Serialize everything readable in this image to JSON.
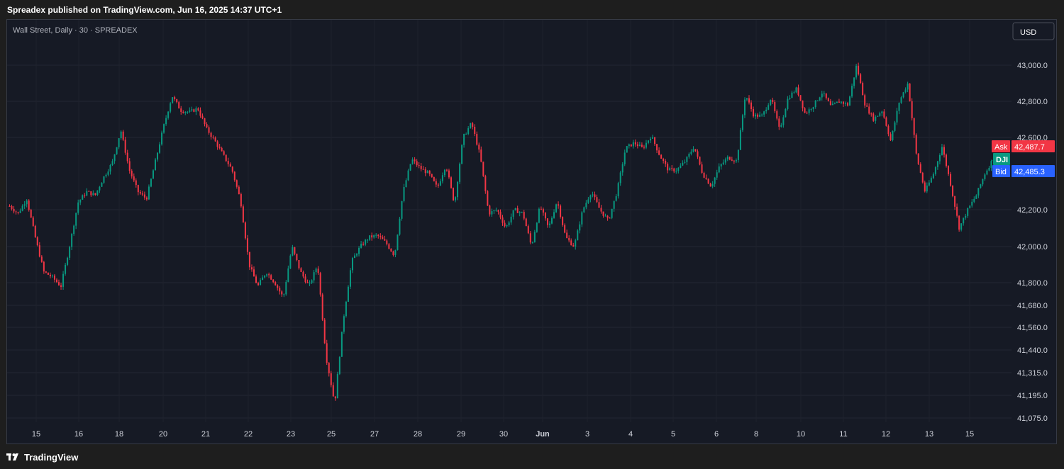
{
  "header": {
    "published_text": "Spreadex published on TradingView.com, Jun 16, 2025 14:37 UTC+1"
  },
  "footer": {
    "logo_text": "TradingView"
  },
  "chart_data": {
    "type": "candlestick",
    "symbol_label": "Wall Street, Daily · 30 · SPREADEX",
    "currency": "USD",
    "price_scale": {
      "ticks": [
        "43,000.0",
        "42,800.0",
        "42,600.0",
        "42,200.0",
        "42,000.0",
        "41,800.0",
        "41,680.0",
        "41,560.0",
        "41,440.0",
        "41,315.0",
        "41,195.0",
        "41,075.0"
      ],
      "tick_values": [
        43000,
        42800,
        42600,
        42200,
        42000,
        41800,
        41680,
        41560,
        41440,
        41315,
        41195,
        41075
      ],
      "range": [
        41075,
        43100
      ]
    },
    "time_scale": {
      "labels": [
        "15",
        "16",
        "18",
        "20",
        "21",
        "22",
        "23",
        "25",
        "27",
        "28",
        "29",
        "30",
        "Jun",
        "3",
        "4",
        "5",
        "6",
        "8",
        "10",
        "11",
        "12",
        "13",
        "15"
      ]
    },
    "markers": {
      "ask": {
        "label": "Ask",
        "value": "42,487.7",
        "color": "#f23645"
      },
      "bid": {
        "label": "Bid",
        "value": "42,485.3",
        "color": "#2962ff"
      },
      "symbol": {
        "label": "DJI",
        "color": "#089981"
      }
    },
    "series": [
      {
        "name": "DJI",
        "approx_path_values": [
          42220,
          42180,
          42260,
          42050,
          41860,
          41830,
          41780,
          42000,
          42240,
          42300,
          42280,
          42380,
          42460,
          42640,
          42420,
          42300,
          42260,
          42460,
          42660,
          42830,
          42750,
          42740,
          42760,
          42650,
          42580,
          42500,
          42420,
          42250,
          41900,
          41780,
          41860,
          41800,
          41720,
          42000,
          41860,
          41780,
          41900,
          41400,
          41150,
          41600,
          41920,
          42000,
          42050,
          42060,
          42020,
          41950,
          42300,
          42480,
          42430,
          42400,
          42320,
          42450,
          42230,
          42600,
          42680,
          42500,
          42180,
          42200,
          42100,
          42200,
          42180,
          42000,
          42220,
          42100,
          42250,
          42050,
          42000,
          42200,
          42300,
          42200,
          42140,
          42300,
          42540,
          42570,
          42540,
          42610,
          42500,
          42420,
          42420,
          42470,
          42550,
          42400,
          42330,
          42440,
          42490,
          42470,
          42840,
          42720,
          42720,
          42820,
          42640,
          42820,
          42870,
          42730,
          42780,
          42850,
          42770,
          42800,
          42780,
          43000,
          42780,
          42700,
          42750,
          42580,
          42800,
          42900,
          42500,
          42300,
          42400,
          42550,
          42340,
          42100,
          42200,
          42280,
          42400,
          42485
        ]
      }
    ],
    "grid": true,
    "up_color": "#089981",
    "down_color": "#f23645",
    "background": "#161a25"
  }
}
